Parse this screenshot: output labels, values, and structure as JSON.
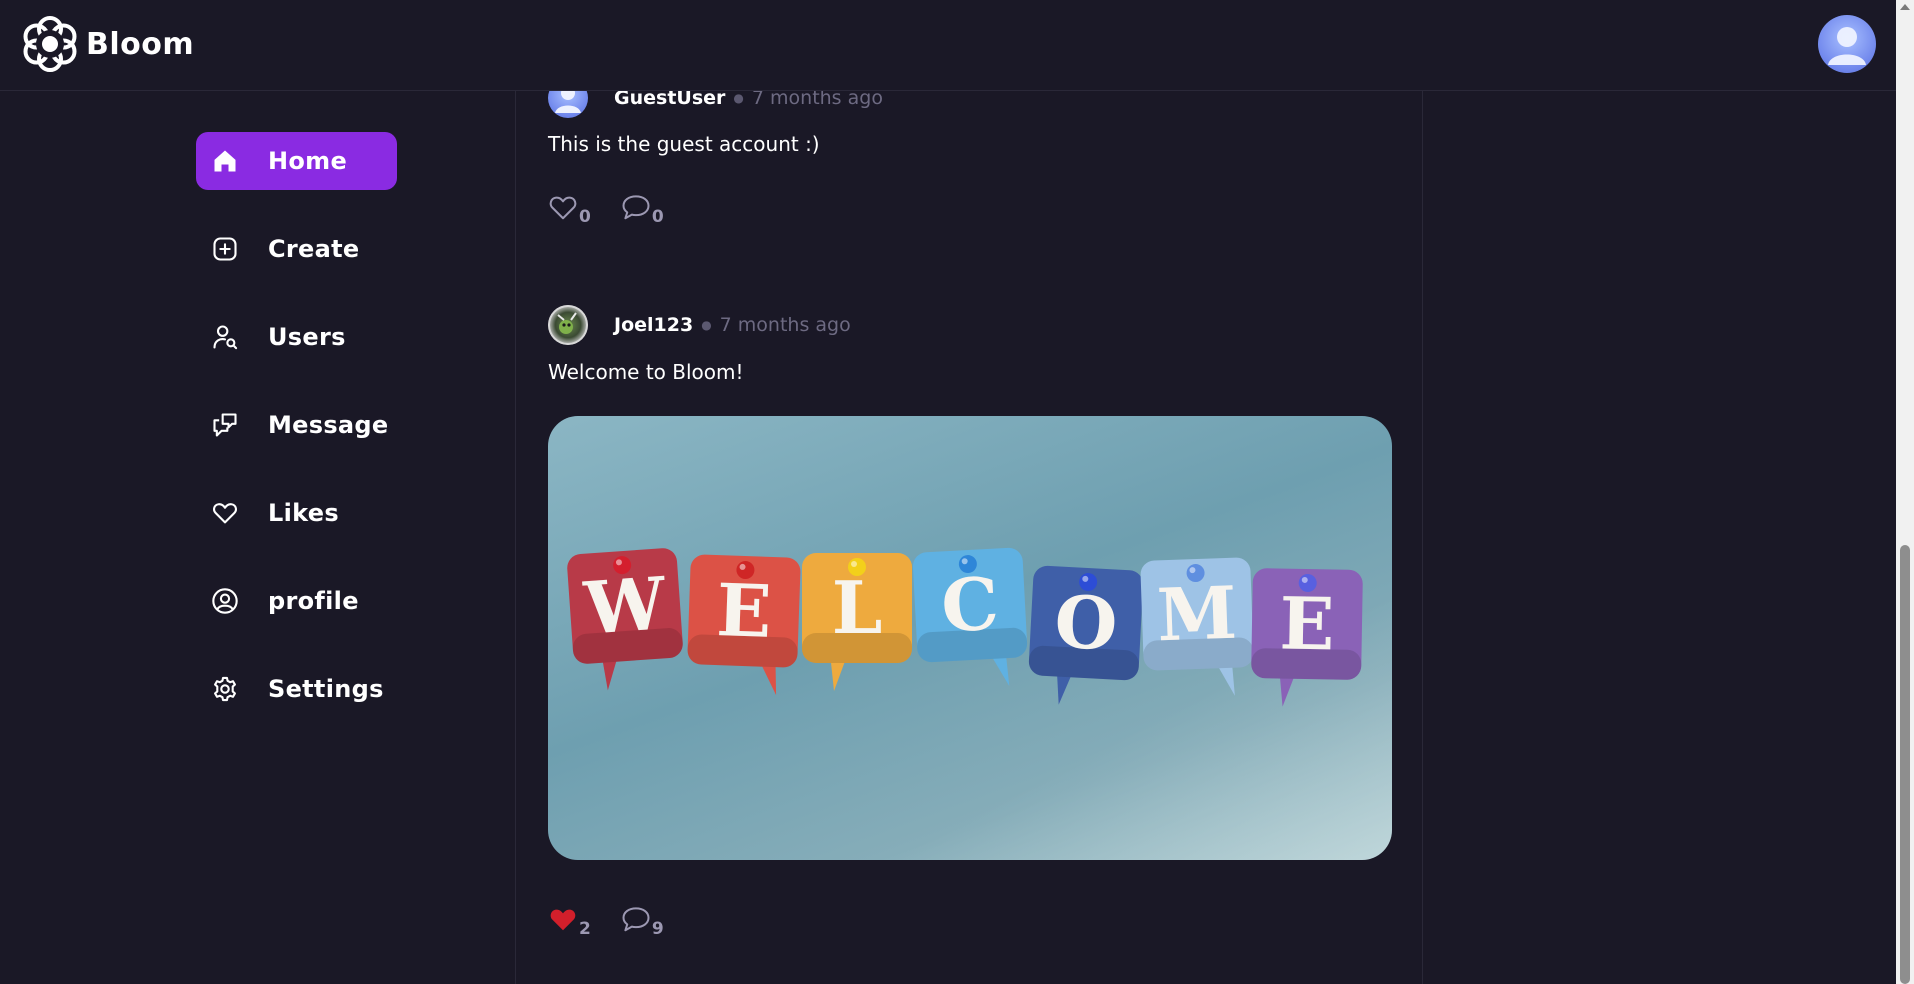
{
  "app": {
    "name": "Bloom",
    "accent_color": "#8a2be2",
    "background_color": "#1a1826"
  },
  "sidebar": {
    "items": [
      {
        "label": "Home",
        "icon": "home-icon",
        "active": true
      },
      {
        "label": "Create",
        "icon": "plus-square-icon"
      },
      {
        "label": "Users",
        "icon": "user-search-icon"
      },
      {
        "label": "Message",
        "icon": "chat-bubbles-icon"
      },
      {
        "label": "Likes",
        "icon": "heart-outline-icon"
      },
      {
        "label": "profile",
        "icon": "user-circle-icon"
      },
      {
        "label": "Settings",
        "icon": "gear-icon"
      }
    ]
  },
  "posts": [
    {
      "username": "GuestUser",
      "time": "7 months ago",
      "text": "This is the guest account :)",
      "likes": "0",
      "comments": "0",
      "liked": false
    },
    {
      "username": "Joel123",
      "time": "7 months ago",
      "text": "Welcome to Bloom!",
      "image": {
        "letters": [
          "W",
          "E",
          "L",
          "C",
          "O",
          "M",
          "E"
        ],
        "tile_colors": [
          "#b83a48",
          "#dc5246",
          "#eeaa3e",
          "#5fb1e2",
          "#3f5fa8",
          "#9ec3e6",
          "#8a62b7"
        ],
        "pin_colors": [
          "#d41f2e",
          "#cf2626",
          "#f3d01a",
          "#2e86d8",
          "#2d4dd6",
          "#5f8fe0",
          "#5860e0"
        ]
      },
      "likes": "2",
      "comments": "9",
      "liked": true,
      "like_color": "#d21f2b"
    }
  ]
}
